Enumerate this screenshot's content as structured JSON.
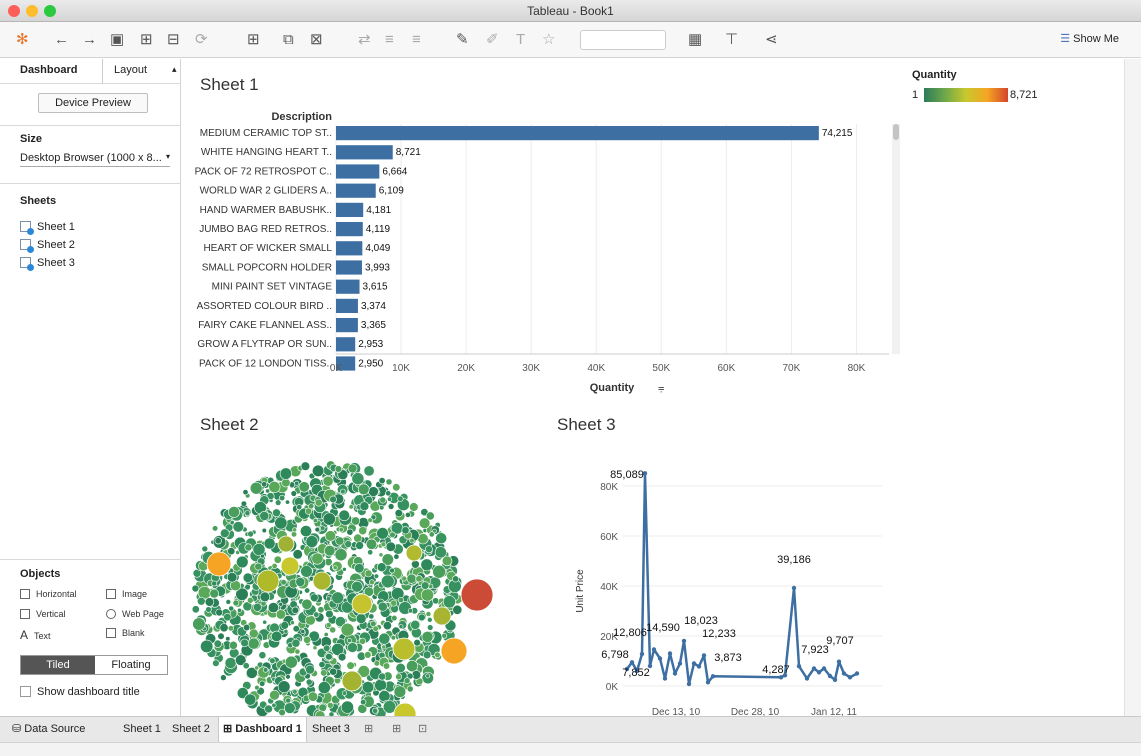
{
  "window": {
    "title": "Tableau - Book1"
  },
  "toolbar": {
    "show_me": "Show Me"
  },
  "sidebar": {
    "tabs": [
      "Dashboard",
      "Layout"
    ],
    "device_preview": "Device Preview",
    "size_header": "Size",
    "size_value": "Desktop Browser (1000 x 8...",
    "sheets_header": "Sheets",
    "sheets": [
      "Sheet 1",
      "Sheet 2",
      "Sheet 3"
    ],
    "objects_header": "Objects",
    "objects": [
      "Horizontal",
      "Image",
      "Vertical",
      "Web Page",
      "Text",
      "Blank"
    ],
    "tiled": "Tiled",
    "floating": "Floating",
    "show_title": "Show dashboard title"
  },
  "sheet1": {
    "title": "Sheet 1",
    "chart_data": {
      "type": "bar",
      "orientation": "horizontal",
      "ylabel": "Description",
      "xlabel": "Quantity",
      "categories": [
        "MEDIUM CERAMIC TOP ST..",
        "WHITE HANGING HEART T..",
        "PACK OF 72 RETROSPOT C..",
        "WORLD WAR 2 GLIDERS A..",
        "HAND WARMER BABUSHK..",
        "JUMBO BAG RED RETROS..",
        "HEART OF WICKER SMALL",
        "SMALL POPCORN HOLDER",
        "MINI PAINT SET VINTAGE",
        "ASSORTED COLOUR BIRD ..",
        "FAIRY CAKE FLANNEL ASS..",
        "GROW A FLYTRAP OR SUN..",
        "PACK OF 12 LONDON TISS.."
      ],
      "values": [
        74215,
        8721,
        6664,
        6109,
        4181,
        4119,
        4049,
        3993,
        3615,
        3374,
        3365,
        2953,
        2950
      ],
      "value_labels": [
        "74,215",
        "8,721",
        "6,664",
        "6,109",
        "4,181",
        "4,119",
        "4,049",
        "3,993",
        "3,615",
        "3,374",
        "3,365",
        "2,953",
        "2,950"
      ],
      "xticks": [
        "0K",
        "10K",
        "20K",
        "30K",
        "40K",
        "50K",
        "60K",
        "70K",
        "80K"
      ],
      "xlim": [
        0,
        85000
      ],
      "color": "#3d6fa3"
    }
  },
  "legend": {
    "title": "Quantity",
    "min": "1",
    "max": "8,721"
  },
  "sheet2": {
    "title": "Sheet 2"
  },
  "sheet3": {
    "title": "Sheet 3",
    "chart_data": {
      "type": "line",
      "ylabel": "Unit Price",
      "ylim": [
        0,
        90000
      ],
      "yticks": [
        "0K",
        "20K",
        "40K",
        "60K",
        "80K"
      ],
      "xticks": [
        "Dec 13, 10",
        "Dec 28, 10",
        "Jan 12, 11"
      ],
      "labels": [
        "85,089",
        "39,186",
        "18,023",
        "14,590",
        "12,806",
        "12,233",
        "9,707",
        "7,923",
        "7,852",
        "6,798",
        "4,287",
        "3,873"
      ],
      "color": "#3d6fa3"
    }
  },
  "tabs": {
    "data_source": "Data Source",
    "sheets": [
      "Sheet 1",
      "Sheet 2",
      "Dashboard 1",
      "Sheet 3"
    ]
  }
}
